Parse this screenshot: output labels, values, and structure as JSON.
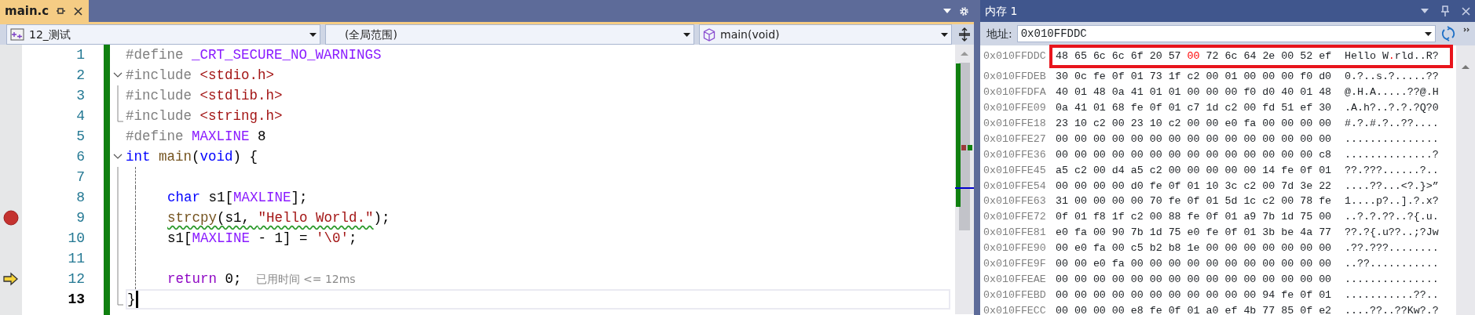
{
  "editor": {
    "tab": {
      "title": "main.c",
      "selected": true
    },
    "navigation": {
      "project": "12_测试",
      "scope": "(全局范围)",
      "member": "main(void)"
    },
    "lines": [
      {
        "number": "1",
        "kind": "plain",
        "breakpoint": false,
        "execution_point": false,
        "current": false,
        "in_block": false,
        "tokens": [
          {
            "text": "#define ",
            "kind": "pp"
          },
          {
            "text": "_CRT_SECURE_NO_WARNINGS",
            "kind": "macro"
          }
        ]
      },
      {
        "number": "2",
        "kind": "open",
        "expanded": true,
        "breakpoint": false,
        "execution_point": false,
        "current": false,
        "in_block": false,
        "tokens": [
          {
            "text": "#include ",
            "kind": "pp"
          },
          {
            "text": "<stdio.h>",
            "kind": "str"
          }
        ]
      },
      {
        "number": "3",
        "kind": "inner",
        "breakpoint": false,
        "execution_point": false,
        "current": false,
        "in_block": false,
        "tokens": [
          {
            "text": "#include ",
            "kind": "pp"
          },
          {
            "text": "<stdlib.h>",
            "kind": "str"
          }
        ]
      },
      {
        "number": "4",
        "kind": "close",
        "breakpoint": false,
        "execution_point": false,
        "current": false,
        "in_block": false,
        "tokens": [
          {
            "text": "#include ",
            "kind": "pp"
          },
          {
            "text": "<string.h>",
            "kind": "str"
          }
        ]
      },
      {
        "number": "5",
        "kind": "plain",
        "breakpoint": false,
        "execution_point": false,
        "current": false,
        "in_block": false,
        "tokens": [
          {
            "text": "#define ",
            "kind": "pp"
          },
          {
            "text": "MAXLINE",
            "kind": "macro"
          },
          {
            "text": " 8",
            "kind": "plain"
          }
        ]
      },
      {
        "number": "6",
        "kind": "open",
        "expanded": true,
        "breakpoint": false,
        "execution_point": false,
        "current": false,
        "in_block": false,
        "tokens": [
          {
            "text": "int",
            "kind": "kw"
          },
          {
            "text": " main",
            "kind": "fn"
          },
          {
            "text": "(",
            "kind": "plain"
          },
          {
            "text": "void",
            "kind": "kw"
          },
          {
            "text": ") {",
            "kind": "plain"
          }
        ]
      },
      {
        "number": "7",
        "kind": "inner",
        "breakpoint": false,
        "execution_point": false,
        "current": false,
        "in_block": true
      },
      {
        "number": "8",
        "kind": "inner",
        "breakpoint": false,
        "execution_point": false,
        "current": false,
        "in_block": true,
        "tokens": [
          {
            "text": "char",
            "kind": "kw"
          },
          {
            "text": " s1[",
            "kind": "plain"
          },
          {
            "text": "MAXLINE",
            "kind": "macro"
          },
          {
            "text": "];",
            "kind": "plain"
          }
        ]
      },
      {
        "number": "9",
        "kind": "inner",
        "breakpoint": true,
        "execution_point": false,
        "current": false,
        "in_block": true,
        "tokens": [
          {
            "text": "strcpy",
            "kind": "fn",
            "squiggle": true
          },
          {
            "text": "(s1, ",
            "kind": "plain",
            "squiggle": true
          },
          {
            "text": "\"Hello World.\"",
            "kind": "str",
            "squiggle": true
          },
          {
            "text": ");",
            "kind": "plain"
          }
        ]
      },
      {
        "number": "10",
        "kind": "inner",
        "breakpoint": false,
        "execution_point": false,
        "current": false,
        "in_block": true,
        "tokens": [
          {
            "text": "s1[",
            "kind": "plain"
          },
          {
            "text": "MAXLINE",
            "kind": "macro"
          },
          {
            "text": " - 1] = ",
            "kind": "plain"
          },
          {
            "text": "'\\0'",
            "kind": "str"
          },
          {
            "text": ";",
            "kind": "plain"
          }
        ]
      },
      {
        "number": "11",
        "kind": "inner",
        "breakpoint": false,
        "execution_point": false,
        "current": false,
        "in_block": true
      },
      {
        "number": "12",
        "kind": "inner",
        "breakpoint": false,
        "execution_point": true,
        "current": false,
        "in_block": true,
        "tokens": [
          {
            "text": "return",
            "kind": "ctrl"
          },
          {
            "text": " 0;",
            "kind": "plain"
          }
        ],
        "hint": "已用时间 <= 12ms"
      },
      {
        "number": "13",
        "kind": "close",
        "breakpoint": false,
        "execution_point": false,
        "current": true,
        "in_block": false,
        "tokens": [
          {
            "text": "}",
            "kind": "plain"
          }
        ]
      }
    ]
  },
  "memory": {
    "title": "内存 1",
    "address_label": "地址:",
    "address": "0x010FFDDC",
    "rows": [
      {
        "address": "0x010FFDDC",
        "annotated": true,
        "bytes": [
          {
            "text": "48 65 6c 6c 6f 20 57",
            "changed": false
          },
          {
            "text": "00",
            "changed": true
          },
          {
            "text": "72 6c 64 2e 00 52 ef",
            "changed": false
          }
        ],
        "chars": [
          {
            "text": "Hello W",
            "changed": false
          },
          {
            "text": ".",
            "changed": true
          },
          {
            "text": "rld..R?",
            "changed": false
          }
        ]
      },
      {
        "address": "0x010FFDEB",
        "annotated": false,
        "bytes": [
          {
            "text": "30 0c fe 0f 01 73 1f c2 00 01 00 00 00 f0 d0",
            "changed": false
          }
        ],
        "chars": [
          {
            "text": "0.?..s.?.....??",
            "changed": false
          }
        ]
      },
      {
        "address": "0x010FFDFA",
        "annotated": false,
        "bytes": [
          {
            "text": "40 01 48 0a 41 01 01 00 00 00 f0 d0 40 01 48",
            "changed": false
          }
        ],
        "chars": [
          {
            "text": "@.H.A.....??@.H",
            "changed": false
          }
        ]
      },
      {
        "address": "0x010FFE09",
        "annotated": false,
        "bytes": [
          {
            "text": "0a 41 01 68 fe 0f 01 c7 1d c2 00 fd 51 ef 30",
            "changed": false
          }
        ],
        "chars": [
          {
            "text": ".A.h?..?.?.?Q?0",
            "changed": false
          }
        ]
      },
      {
        "address": "0x010FFE18",
        "annotated": false,
        "bytes": [
          {
            "text": "23 10 c2 00 23 10 c2 00 00 e0 fa 00 00 00 00",
            "changed": false
          }
        ],
        "chars": [
          {
            "text": "#.?.#.?..??....",
            "changed": false
          }
        ]
      },
      {
        "address": "0x010FFE27",
        "annotated": false,
        "bytes": [
          {
            "text": "00 00 00 00 00 00 00 00 00 00 00 00 00 00 00",
            "changed": false
          }
        ],
        "chars": [
          {
            "text": "...............",
            "changed": false
          }
        ]
      },
      {
        "address": "0x010FFE36",
        "annotated": false,
        "bytes": [
          {
            "text": "00 00 00 00 00 00 00 00 00 00 00 00 00 00 c8",
            "changed": false
          }
        ],
        "chars": [
          {
            "text": "..............?",
            "changed": false
          }
        ]
      },
      {
        "address": "0x010FFE45",
        "annotated": false,
        "bytes": [
          {
            "text": "a5 c2 00 d4 a5 c2 00 00 00 00 00 14 fe 0f 01",
            "changed": false
          }
        ],
        "chars": [
          {
            "text": "??.???......?..",
            "changed": false
          }
        ]
      },
      {
        "address": "0x010FFE54",
        "annotated": false,
        "bytes": [
          {
            "text": "00 00 00 00 d0 fe 0f 01 10 3c c2 00 7d 3e 22",
            "changed": false
          }
        ],
        "chars": [
          {
            "text": "....??...<?.}>”",
            "changed": false
          }
        ]
      },
      {
        "address": "0x010FFE63",
        "annotated": false,
        "bytes": [
          {
            "text": "31 00 00 00 00 70 fe 0f 01 5d 1c c2 00 78 fe",
            "changed": false
          }
        ],
        "chars": [
          {
            "text": "1....p?..].?.x?",
            "changed": false
          }
        ]
      },
      {
        "address": "0x010FFE72",
        "annotated": false,
        "bytes": [
          {
            "text": "0f 01 f8 1f c2 00 88 fe 0f 01 a9 7b 1d 75 00",
            "changed": false
          }
        ],
        "chars": [
          {
            "text": "..?.?.??..?{.u.",
            "changed": false
          }
        ]
      },
      {
        "address": "0x010FFE81",
        "annotated": false,
        "bytes": [
          {
            "text": "e0 fa 00 90 7b 1d 75 e0 fe 0f 01 3b be 4a 77",
            "changed": false
          }
        ],
        "chars": [
          {
            "text": "??.?{.u??..;?Jw",
            "changed": false
          }
        ]
      },
      {
        "address": "0x010FFE90",
        "annotated": false,
        "bytes": [
          {
            "text": "00 e0 fa 00 c5 b2 b8 1e 00 00 00 00 00 00 00",
            "changed": false
          }
        ],
        "chars": [
          {
            "text": ".??.???........",
            "changed": false
          }
        ]
      },
      {
        "address": "0x010FFE9F",
        "annotated": false,
        "bytes": [
          {
            "text": "00 00 e0 fa 00 00 00 00 00 00 00 00 00 00 00",
            "changed": false
          }
        ],
        "chars": [
          {
            "text": "..??...........",
            "changed": false
          }
        ]
      },
      {
        "address": "0x010FFEAE",
        "annotated": false,
        "bytes": [
          {
            "text": "00 00 00 00 00 00 00 00 00 00 00 00 00 00 00",
            "changed": false
          }
        ],
        "chars": [
          {
            "text": "...............",
            "changed": false
          }
        ]
      },
      {
        "address": "0x010FFEBD",
        "annotated": false,
        "bytes": [
          {
            "text": "00 00 00 00 00 00 00 00 00 00 00 94 fe 0f 01",
            "changed": false
          }
        ],
        "chars": [
          {
            "text": "...........??..",
            "changed": false
          }
        ]
      },
      {
        "address": "0x010FFECC",
        "annotated": false,
        "bytes": [
          {
            "text": "00 00 00 00 e8 fe 0f 01 a0 ef 4b 77 85 0f e2",
            "changed": false
          }
        ],
        "chars": [
          {
            "text": "....??..??Kw?.?",
            "changed": false
          }
        ]
      }
    ]
  }
}
